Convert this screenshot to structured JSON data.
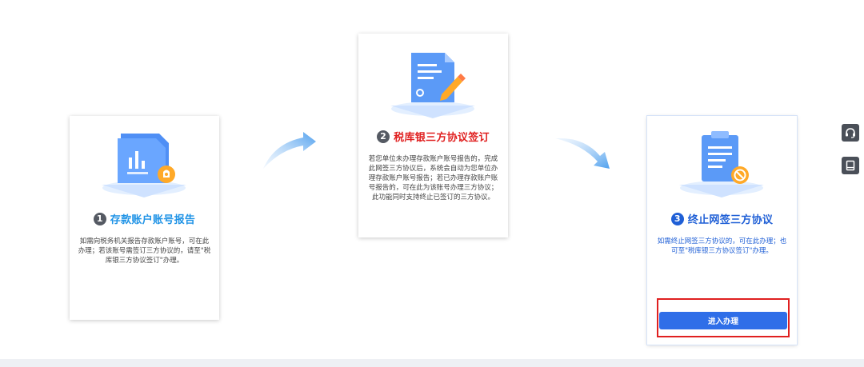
{
  "steps": [
    {
      "number": "1",
      "title": "存款账户账号报告",
      "description": "如需向税务机关报告存款账户账号，可在此办理；若该账号需签订三方协议的，请至\"税库银三方协议签订\"办理。",
      "icon": "bank-account-document-icon"
    },
    {
      "number": "2",
      "title": "税库银三方协议签订",
      "description": "若您单位未办理存款账户账号报告的，完成此网签三方协议后，系统会自动为您单位办理存款账户账号报告；若已办理存款账户账号报告的，可在此为该账号办理三方协议；此功能同时支持终止已签订的三方协议。",
      "icon": "document-edit-icon"
    },
    {
      "number": "3",
      "title": "终止网签三方协议",
      "description": "如需终止网签三方协议的，可在此办理；也可至\"税库银三方协议签订\"办理。",
      "icon": "clipboard-cancel-icon",
      "button_label": "进入办理"
    }
  ],
  "side_tools": [
    {
      "icon": "headset-support-icon"
    },
    {
      "icon": "manual-book-icon"
    }
  ],
  "colors": {
    "step1_title": "#1f93e6",
    "step2_title": "#e02020",
    "step3_title": "#1f5fd6",
    "primary_button": "#2f6ee8",
    "highlight_border": "#e02020",
    "side_icon_bg": "#4a4f58"
  }
}
